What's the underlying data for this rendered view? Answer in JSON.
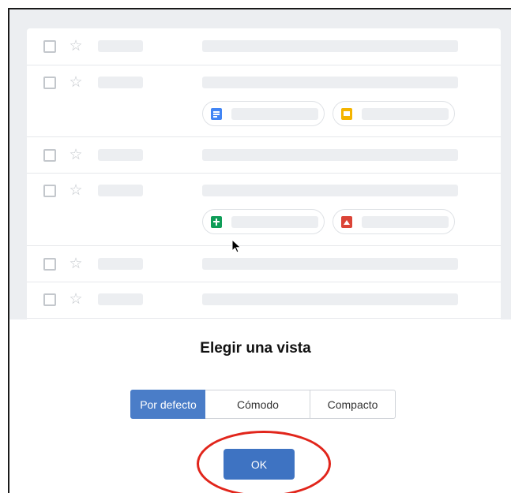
{
  "dialog": {
    "title": "Elegir una vista",
    "options": [
      "Por defecto",
      "Cómodo",
      "Compacto"
    ],
    "selected": "Por defecto",
    "ok_label": "OK"
  },
  "preview": {
    "star_glyph": "☆",
    "rows": [
      {
        "attachments": []
      },
      {
        "attachments": [
          "doc-icon",
          "slides-icon"
        ]
      },
      {
        "attachments": []
      },
      {
        "attachments": [
          "sheets-icon",
          "photo-icon"
        ]
      },
      {
        "attachments": []
      },
      {
        "attachments": []
      }
    ]
  },
  "colors": {
    "accent": "#4a7dc8",
    "ok_button": "#3e73c2",
    "highlight_ring": "#e1251b"
  }
}
